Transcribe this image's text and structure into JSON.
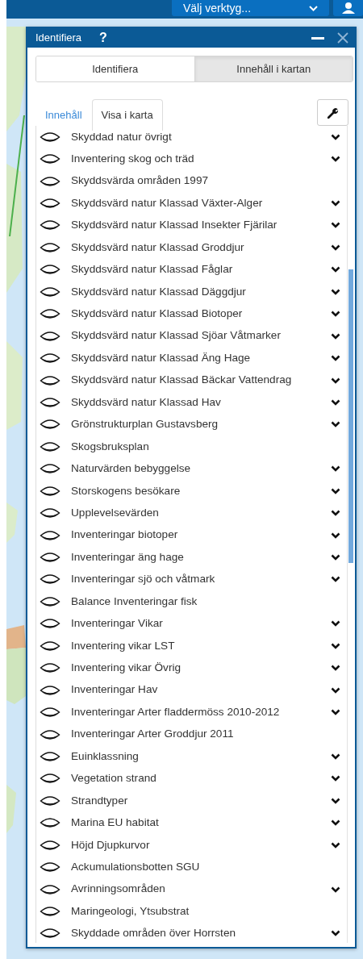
{
  "top_bar": {
    "tool_select": "Välj verktyg..."
  },
  "panel": {
    "title": "Identifiera",
    "help": "?",
    "segments": [
      {
        "label": "Identifiera",
        "selected": false
      },
      {
        "label": "Innehåll i kartan",
        "selected": true
      }
    ],
    "tabs": [
      {
        "label": "Innehåll",
        "selected": false
      },
      {
        "label": "Visa i karta",
        "selected": true
      }
    ],
    "layers": [
      {
        "name": "Skyddad natur övrigt",
        "expandable": true
      },
      {
        "name": "Inventering skog och träd",
        "expandable": true
      },
      {
        "name": "Skyddsvärda områden 1997",
        "expandable": false
      },
      {
        "name": "Skyddsvärd natur Klassad Växter-Alger",
        "expandable": true
      },
      {
        "name": "Skyddsvärd natur Klassad Insekter Fjärilar",
        "expandable": true
      },
      {
        "name": "Skyddsvärd natur Klassad Groddjur",
        "expandable": true
      },
      {
        "name": "Skyddsvärd natur Klassad Fåglar",
        "expandable": true
      },
      {
        "name": "Skyddsvärd natur Klassad Däggdjur",
        "expandable": true
      },
      {
        "name": "Skyddsvärd natur Klassad Biotoper",
        "expandable": true
      },
      {
        "name": "Skyddsvärd natur Klassad Sjöar Våtmarker",
        "expandable": true
      },
      {
        "name": "Skyddsvärd natur Klassad Äng Hage",
        "expandable": true
      },
      {
        "name": "Skyddsvärd natur Klassad Bäckar Vattendrag",
        "expandable": true
      },
      {
        "name": "Skyddsvärd natur Klassad Hav",
        "expandable": true
      },
      {
        "name": "Grönstrukturplan Gustavsberg",
        "expandable": true
      },
      {
        "name": "Skogsbruksplan",
        "expandable": false
      },
      {
        "name": "Naturvärden bebyggelse",
        "expandable": true
      },
      {
        "name": "Storskogens besökare",
        "expandable": true
      },
      {
        "name": "Upplevelsevärden",
        "expandable": true
      },
      {
        "name": "Inventeringar biotoper",
        "expandable": true
      },
      {
        "name": "Inventeringar äng hage",
        "expandable": true
      },
      {
        "name": "Inventeringar sjö och våtmark",
        "expandable": true
      },
      {
        "name": "Balance Inventeringar fisk",
        "expandable": false
      },
      {
        "name": "Inventeringar Vikar",
        "expandable": true
      },
      {
        "name": "Inventering vikar LST",
        "expandable": true
      },
      {
        "name": "Inventering vikar Övrig",
        "expandable": true
      },
      {
        "name": "Inventeringar Hav",
        "expandable": true
      },
      {
        "name": "Inventeringar Arter fladdermöss 2010-2012",
        "expandable": true
      },
      {
        "name": "Inventeringar Arter Groddjur 2011",
        "expandable": false
      },
      {
        "name": "Euinklassning",
        "expandable": true
      },
      {
        "name": "Vegetation strand",
        "expandable": true
      },
      {
        "name": "Strandtyper",
        "expandable": true
      },
      {
        "name": "Marina EU habitat",
        "expandable": true
      },
      {
        "name": "Höjd Djupkurvor",
        "expandable": true
      },
      {
        "name": "Ackumulationsbotten SGU",
        "expandable": false
      },
      {
        "name": "Avrinningsområden",
        "expandable": true
      },
      {
        "name": "Maringeologi, Ytsubstrat",
        "expandable": false
      },
      {
        "name": "Skyddade områden över Horrsten",
        "expandable": true
      }
    ]
  }
}
